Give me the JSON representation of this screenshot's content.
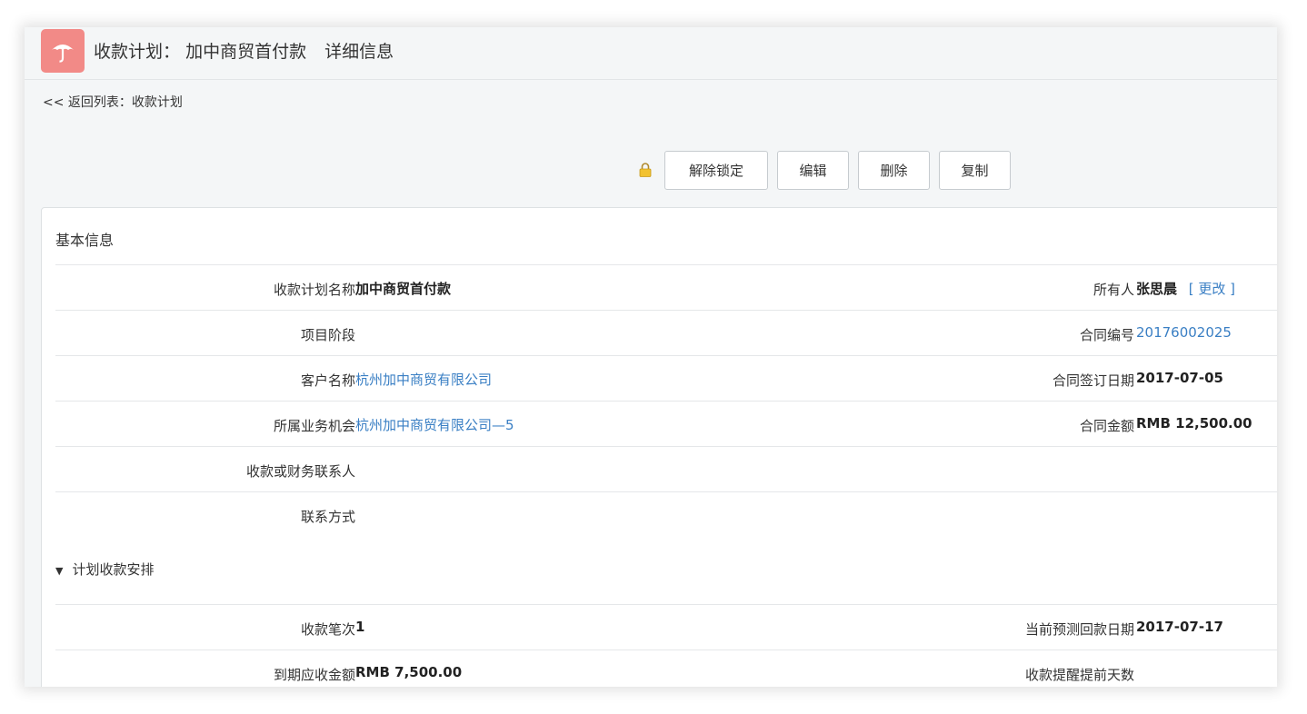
{
  "header": {
    "title_prefix": "收款计划：",
    "title_name": "加中商贸首付款",
    "title_suffix": "详细信息",
    "icon": "umbrella-icon",
    "accent_color": "#f28a87"
  },
  "back_link": "<< 返回列表：收款计划",
  "toolbar": {
    "lock_icon": "lock-icon",
    "unlock_label": "解除锁定",
    "edit_label": "编辑",
    "delete_label": "删除",
    "copy_label": "复制"
  },
  "basic_info": {
    "title": "基本信息",
    "plan_name_label": "收款计划名称",
    "plan_name_value": "加中商贸首付款",
    "owner_label": "所有人",
    "owner_value": "张思晨",
    "owner_change": "[ 更改 ]",
    "stage_label": "项目阶段",
    "contract_no_label": "合同编号",
    "contract_no_value": "20176002025",
    "customer_label": "客户名称",
    "customer_value": "杭州加中商贸有限公司",
    "sign_date_label": "合同签订日期",
    "sign_date_value": "2017-07-05",
    "opportunity_label": "所属业务机会",
    "opportunity_value": "杭州加中商贸有限公司—5",
    "amount_label": "合同金额",
    "amount_value": "RMB 12,500.00",
    "contact_label": "收款或财务联系人",
    "contact_method_label": "联系方式"
  },
  "schedule": {
    "title": "计划收款安排",
    "toggle_icon": "triangle-down-icon",
    "installment_label": "收款笔次",
    "installment_value": "1",
    "forecast_date_label": "当前预测回款日期",
    "forecast_date_value": "2017-07-17",
    "due_amount_label": "到期应收金额",
    "due_amount_value": "RMB 7,500.00",
    "reminder_days_label": "收款提醒提前天数"
  },
  "link_color": "#3a7fc4"
}
